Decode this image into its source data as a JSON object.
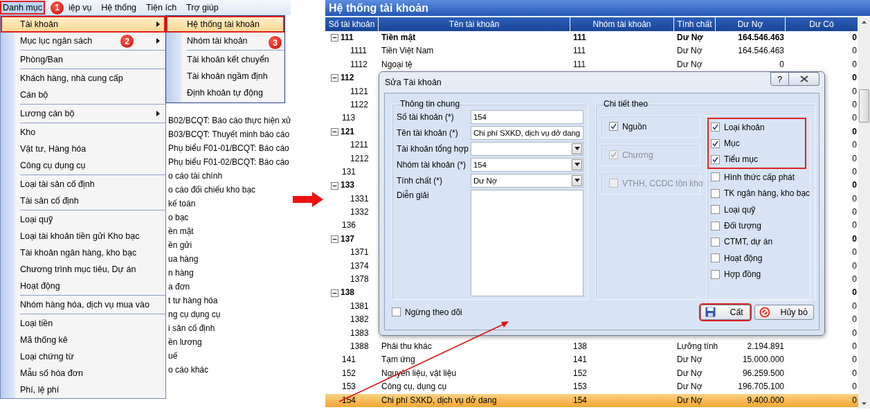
{
  "left_app": {
    "menu_bar": [
      {
        "label": "Danh mục",
        "selected": true,
        "marked": true,
        "badge": "1"
      },
      {
        "label": "iệp vụ",
        "selected": false,
        "marked": false
      },
      {
        "label": "Hệ thống",
        "selected": false,
        "marked": false
      },
      {
        "label": "Tiện ích",
        "selected": false,
        "marked": false
      },
      {
        "label": "Trợ giúp",
        "selected": false,
        "marked": false
      }
    ],
    "background_list": [
      "B02/BCQT: Báo cáo thực hiện xử",
      "B03/BCQT: Thuyết minh báo cáo",
      "Phụ biểu F01-01/BCQT: Báo cáo",
      "Phụ biểu F01-02/BCQT: Báo cáo",
      "o cáo tài chính",
      "o cáo đối chiếu kho bạc",
      "kế toán",
      "o bạc",
      "ền mặt",
      "ền gửi",
      "ua hàng",
      "n hàng",
      "a đơn",
      "t tư hàng hóa",
      "ng cụ dụng cụ",
      "i sản cố định",
      "ền lương",
      "uế",
      "o cáo khác"
    ],
    "menu": [
      {
        "kind": "item",
        "label": "Tài khoản",
        "has_submenu": true,
        "selected": true,
        "marked": true
      },
      {
        "kind": "item",
        "label": "Mục lục ngân sách",
        "has_submenu": true,
        "selected": false,
        "marked": false,
        "badge": "2"
      },
      {
        "kind": "separator"
      },
      {
        "kind": "item",
        "label": "Phòng/Ban",
        "has_submenu": false,
        "selected": false,
        "marked": false
      },
      {
        "kind": "separator"
      },
      {
        "kind": "item",
        "label": "Khách hàng, nhà cung cấp",
        "has_submenu": false,
        "selected": false,
        "marked": false
      },
      {
        "kind": "item",
        "label": "Cán bộ",
        "has_submenu": false,
        "selected": false,
        "marked": false
      },
      {
        "kind": "separator"
      },
      {
        "kind": "item",
        "label": "Lương cán bộ",
        "has_submenu": true,
        "selected": false,
        "marked": false
      },
      {
        "kind": "separator"
      },
      {
        "kind": "item",
        "label": "Kho",
        "has_submenu": false,
        "selected": false,
        "marked": false
      },
      {
        "kind": "item",
        "label": "Vật tư, Hàng hóa",
        "has_submenu": false,
        "selected": false,
        "marked": false
      },
      {
        "kind": "item",
        "label": "Công cụ dụng cụ",
        "has_submenu": false,
        "selected": false,
        "marked": false
      },
      {
        "kind": "separator"
      },
      {
        "kind": "item",
        "label": "Loại tài sản cố định",
        "has_submenu": false,
        "selected": false,
        "marked": false
      },
      {
        "kind": "item",
        "label": "Tài sản cố định",
        "has_submenu": false,
        "selected": false,
        "marked": false
      },
      {
        "kind": "separator"
      },
      {
        "kind": "item",
        "label": "Loại quỹ",
        "has_submenu": false,
        "selected": false,
        "marked": false
      },
      {
        "kind": "item",
        "label": "Loại tài khoản tiền gửi Kho bạc",
        "has_submenu": false,
        "selected": false,
        "marked": false
      },
      {
        "kind": "item",
        "label": "Tài khoản ngân hàng, kho bạc",
        "has_submenu": false,
        "selected": false,
        "marked": false
      },
      {
        "kind": "item",
        "label": "Chương trình mục tiêu, Dự án",
        "has_submenu": false,
        "selected": false,
        "marked": false
      },
      {
        "kind": "item",
        "label": "Hoạt động",
        "has_submenu": false,
        "selected": false,
        "marked": false
      },
      {
        "kind": "separator"
      },
      {
        "kind": "item",
        "label": "Nhóm hàng hóa, dịch vụ mua vào",
        "has_submenu": false,
        "selected": false,
        "marked": false
      },
      {
        "kind": "separator"
      },
      {
        "kind": "item",
        "label": "Loại tiền",
        "has_submenu": false,
        "selected": false,
        "marked": false
      },
      {
        "kind": "item",
        "label": "Mã thống kê",
        "has_submenu": false,
        "selected": false,
        "marked": false
      },
      {
        "kind": "item",
        "label": "Loại chứng từ",
        "has_submenu": false,
        "selected": false,
        "marked": false
      },
      {
        "kind": "item",
        "label": "Mẫu số hóa đơn",
        "has_submenu": false,
        "selected": false,
        "marked": false
      },
      {
        "kind": "item",
        "label": "Phí, lệ phí",
        "has_submenu": false,
        "selected": false,
        "marked": false
      }
    ],
    "submenu": [
      {
        "kind": "item",
        "label": "Hệ thống tài khoản",
        "selected": true,
        "marked": true
      },
      {
        "kind": "item",
        "label": "Nhóm tài khoản",
        "selected": false,
        "marked": false,
        "badge": "3"
      },
      {
        "kind": "separator"
      },
      {
        "kind": "item",
        "label": "Tài khoản kết chuyển",
        "selected": false,
        "marked": false
      },
      {
        "kind": "item",
        "label": "Tài khoản ngầm định",
        "selected": false,
        "marked": false
      },
      {
        "kind": "item",
        "label": "Định khoản tự động",
        "selected": false,
        "marked": false
      }
    ]
  },
  "accounts": {
    "title": "Hệ thống tài khoản",
    "columns": [
      "Số tài khoản",
      "Tên tài khoản",
      "Nhóm tài khoản",
      "Tính chất",
      "Dư Nợ",
      "Dư Có"
    ],
    "rows": [
      {
        "code": "111",
        "name": "Tiền mặt",
        "group": "111",
        "nature": "Dư Nợ",
        "debit": "164.546.463",
        "credit": "0",
        "selected": false,
        "expanded": true,
        "children": [
          {
            "code": "1111",
            "name": "Tiền Việt Nam",
            "group": "111",
            "nature": "Dư Nợ",
            "debit": "164.546.463",
            "credit": "0",
            "selected": false
          },
          {
            "code": "1112",
            "name": "Ngoại tệ",
            "group": "111",
            "nature": "Dư Nợ",
            "debit": "0",
            "credit": "0",
            "selected": false
          }
        ]
      },
      {
        "code": "112",
        "credit": "0",
        "selected": false,
        "expanded": true,
        "children": [
          {
            "code": "1121",
            "credit": "0",
            "selected": false
          },
          {
            "code": "1122",
            "credit": "0",
            "selected": false
          }
        ]
      },
      {
        "code": "113",
        "credit": "0",
        "selected": false
      },
      {
        "code": "121",
        "credit": "0",
        "selected": false,
        "expanded": true,
        "children": [
          {
            "code": "1211",
            "credit": "0",
            "selected": false
          },
          {
            "code": "1212",
            "credit": "0",
            "selected": false
          }
        ]
      },
      {
        "code": "131",
        "credit": "0",
        "selected": false
      },
      {
        "code": "133",
        "credit": "0",
        "selected": false,
        "expanded": true,
        "children": [
          {
            "code": "1331",
            "credit": "0",
            "selected": false
          },
          {
            "code": "1332",
            "credit": "0",
            "selected": false
          }
        ]
      },
      {
        "code": "136",
        "credit": "0",
        "selected": false
      },
      {
        "code": "137",
        "credit": "0",
        "selected": false,
        "expanded": true,
        "children": [
          {
            "code": "1371",
            "credit": "0",
            "selected": false
          },
          {
            "code": "1374",
            "credit": "0",
            "selected": false
          },
          {
            "code": "1378",
            "credit": "0",
            "selected": false
          }
        ]
      },
      {
        "code": "138",
        "credit": "0",
        "selected": false,
        "expanded": true,
        "children": [
          {
            "code": "1381",
            "credit": "0",
            "selected": false
          },
          {
            "code": "1382",
            "credit": "0",
            "selected": false
          },
          {
            "code": "1383",
            "credit": "0",
            "selected": false
          },
          {
            "code": "1388",
            "name": "Phải thu khác",
            "group": "138",
            "nature": "Lưỡng tính",
            "debit": "2.194.891",
            "credit": "0",
            "selected": false
          }
        ]
      },
      {
        "code": "141",
        "name": "Tạm ứng",
        "group": "141",
        "nature": "Dư Nợ",
        "debit": "15.000.000",
        "credit": "0",
        "selected": false
      },
      {
        "code": "152",
        "name": "Nguyên liệu, vật liệu",
        "group": "152",
        "nature": "Dư Nợ",
        "debit": "96.259.500",
        "credit": "0",
        "selected": false
      },
      {
        "code": "153",
        "name": "Công cụ, dụng cụ",
        "group": "153",
        "nature": "Dư Nợ",
        "debit": "196.705.100",
        "credit": "0",
        "selected": false
      },
      {
        "code": "154",
        "name": "Chi phí SXKD, dịch vụ dở dang",
        "group": "154",
        "nature": "Dư Nợ",
        "debit": "9.400.000",
        "credit": "0",
        "selected": true
      }
    ]
  },
  "dialog": {
    "title": "Sửa Tài khoản",
    "help": "?",
    "general": {
      "legend": "Thông tin chung",
      "fields": [
        {
          "kind": "text",
          "label": "Số tài khoản (*)",
          "value": "154"
        },
        {
          "kind": "text",
          "label": "Tên tài khoản (*)",
          "value": "Chi phí SXKD, dịch vụ dở dang"
        },
        {
          "kind": "combo",
          "label": "Tài khoản tổng hợp"
        },
        {
          "kind": "combo",
          "label": "Nhóm tài khoản (*)",
          "value": "154"
        },
        {
          "kind": "combo",
          "label": "Tính chất (*)",
          "value": "Dư Nợ"
        },
        {
          "kind": "memo",
          "label": "Diễn giải"
        }
      ]
    },
    "details": {
      "legend": "Chi tiết theo",
      "left_options": [
        {
          "label": "Nguồn",
          "checked": true,
          "disabled": false
        },
        {
          "label": "Chương",
          "checked": true,
          "disabled": true
        },
        {
          "label": "VTHH, CCDC tồn kho",
          "checked": false,
          "disabled": true
        }
      ],
      "highlighted_options": [
        {
          "label": "Loại khoản",
          "checked": true
        },
        {
          "label": "Mục",
          "checked": true
        },
        {
          "label": "Tiểu mục",
          "checked": true
        }
      ],
      "options": [
        {
          "label": "Hình thức cấp phát",
          "checked": false
        },
        {
          "label": "TK ngân hàng, kho bạc",
          "checked": false
        },
        {
          "label": "Loại quỹ",
          "checked": false
        },
        {
          "label": "Đối tượng",
          "checked": false
        },
        {
          "label": "CTMT, dự án",
          "checked": false
        },
        {
          "label": "Hoạt động",
          "checked": false
        },
        {
          "label": "Hợp đồng",
          "checked": false
        }
      ]
    },
    "stop_tracking": {
      "label": "Ngừng theo dõi",
      "checked": false
    },
    "buttons": [
      {
        "kind": "save",
        "label": "Cất",
        "marked": true
      },
      {
        "kind": "cancel",
        "label": "Hủy bỏ",
        "marked": false
      }
    ]
  }
}
